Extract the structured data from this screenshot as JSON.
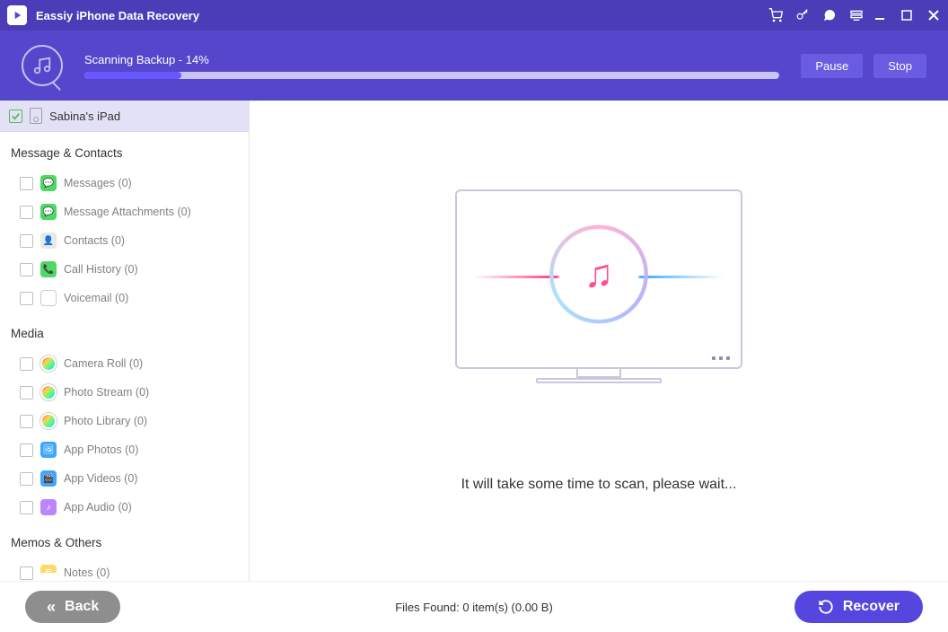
{
  "app": {
    "title": "Eassiy iPhone Data Recovery"
  },
  "header": {
    "progress_label_prefix": "Scanning Backup",
    "progress_percent": 14,
    "progress_label": "Scanning Backup - 14%",
    "pause": "Pause",
    "stop": "Stop"
  },
  "device": {
    "name": "Sabina's iPad"
  },
  "categories": {
    "messages_contacts": {
      "title": "Message & Contacts",
      "items": [
        {
          "label": "Messages (0)",
          "icon": "messages-icon",
          "cls": "ic-green"
        },
        {
          "label": "Message Attachments (0)",
          "icon": "message-attachments-icon",
          "cls": "ic-green"
        },
        {
          "label": "Contacts (0)",
          "icon": "contacts-icon",
          "cls": "ic-gray"
        },
        {
          "label": "Call History (0)",
          "icon": "call-history-icon",
          "cls": "ic-greencall"
        },
        {
          "label": "Voicemail (0)",
          "icon": "voicemail-icon",
          "cls": "ic-white"
        }
      ]
    },
    "media": {
      "title": "Media",
      "items": [
        {
          "label": "Camera Roll (0)",
          "icon": "camera-roll-icon",
          "cls": "ic-multi"
        },
        {
          "label": "Photo Stream (0)",
          "icon": "photo-stream-icon",
          "cls": "ic-multi"
        },
        {
          "label": "Photo Library (0)",
          "icon": "photo-library-icon",
          "cls": "ic-multi"
        },
        {
          "label": "App Photos (0)",
          "icon": "app-photos-icon",
          "cls": "ic-blue"
        },
        {
          "label": "App Videos (0)",
          "icon": "app-videos-icon",
          "cls": "ic-blue"
        },
        {
          "label": "App Audio (0)",
          "icon": "app-audio-icon",
          "cls": "ic-purple"
        }
      ]
    },
    "memos_others": {
      "title": "Memos & Others",
      "items": [
        {
          "label": "Notes (0)",
          "icon": "notes-icon",
          "cls": "ic-notes"
        }
      ]
    }
  },
  "content": {
    "wait_text": "It will take some time to scan, please wait..."
  },
  "footer": {
    "back": "Back",
    "files_found_label": "Files Found: 0 item(s) (0.00 B)",
    "recover": "Recover"
  }
}
